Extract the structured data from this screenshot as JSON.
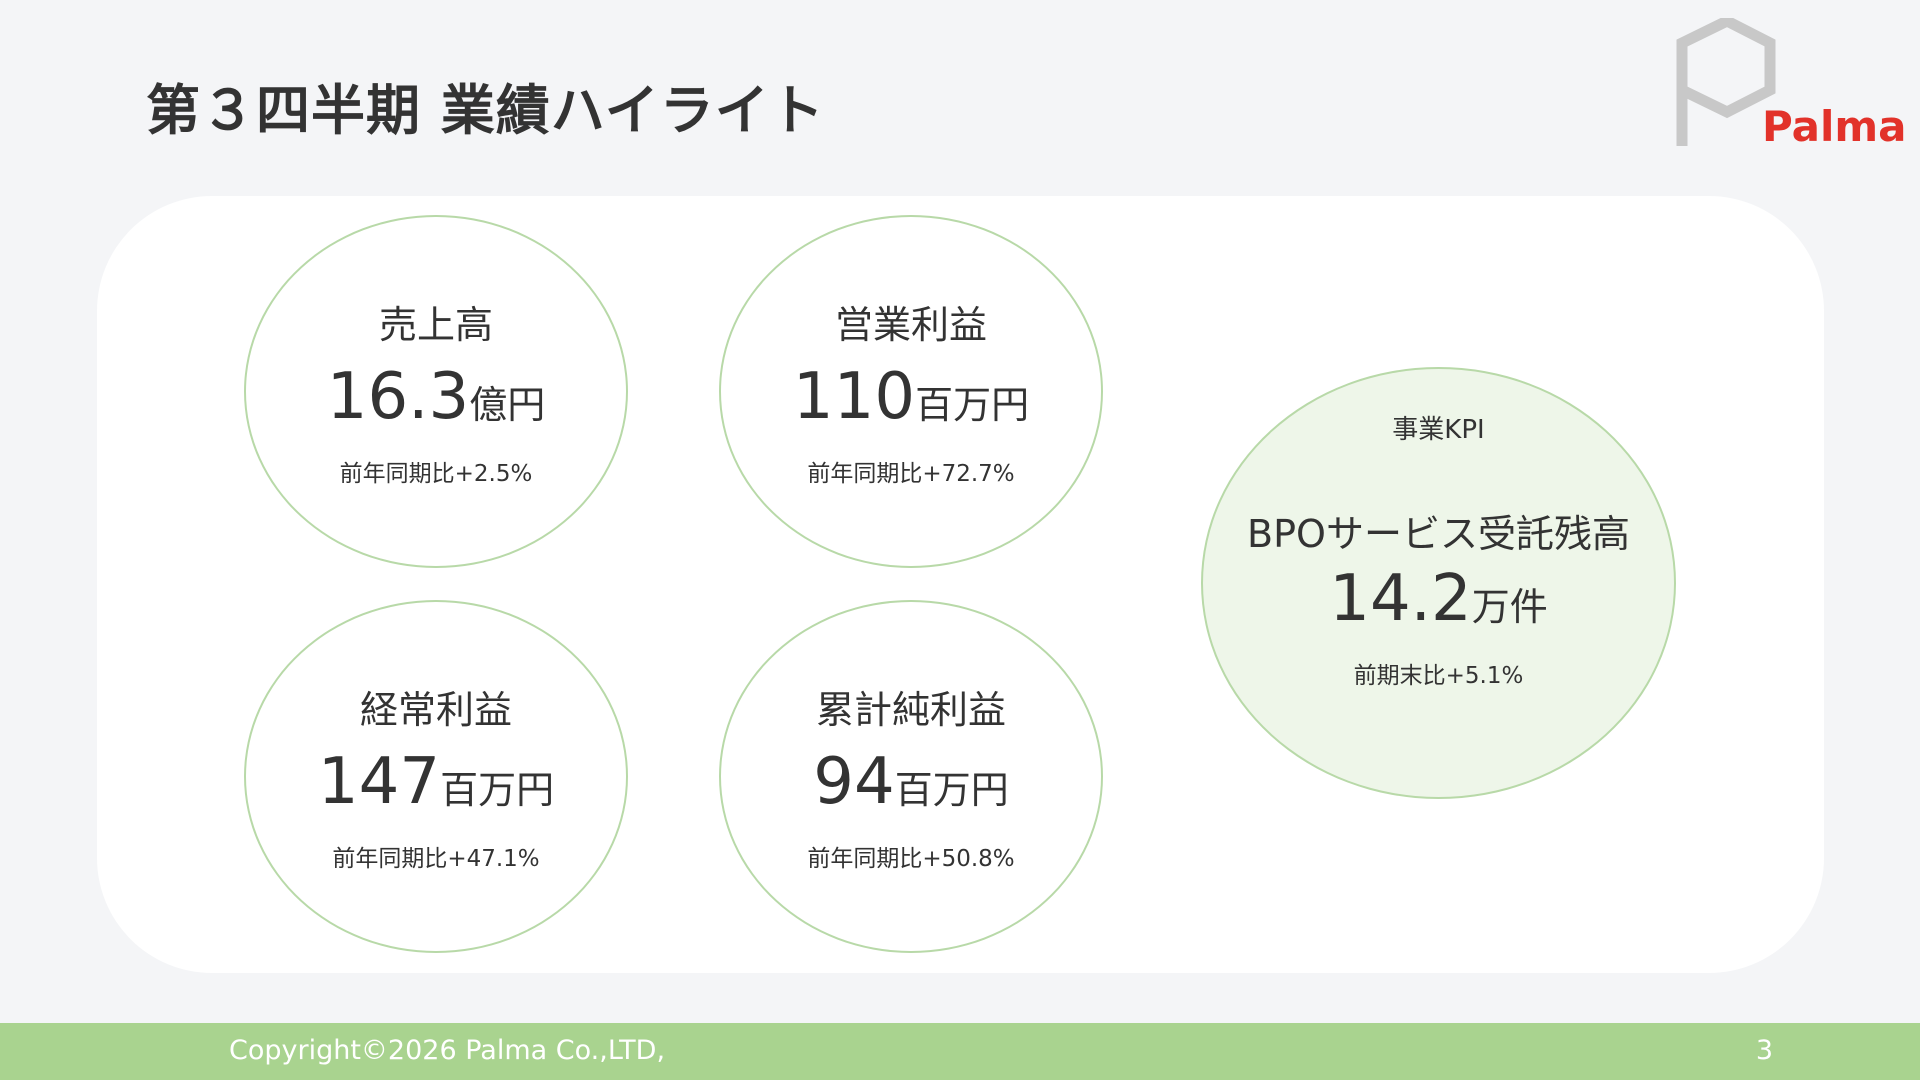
{
  "slide": {
    "title": "第３四半期 業績ハイライト",
    "page_number": "3"
  },
  "logo": {
    "text": "Palma",
    "brand_color": "#e2322a",
    "mark_color": "#c8c8c8"
  },
  "metrics": [
    {
      "label": "売上高",
      "value": "16.3",
      "unit": "億円",
      "note": "前年同期比+2.5%"
    },
    {
      "label": "営業利益",
      "value": "110",
      "unit": "百万円",
      "note": "前年同期比+72.7%"
    },
    {
      "label": "経常利益",
      "value": "147",
      "unit": "百万円",
      "note": "前年同期比+47.1%"
    },
    {
      "label": "累計純利益",
      "value": "94",
      "unit": "百万円",
      "note": "前年同期比+50.8%"
    }
  ],
  "kpi": {
    "header": "事業KPI",
    "label": "BPOサービス受託残高",
    "value": "14.2",
    "unit": "万件",
    "note": "前期末比+5.1%"
  },
  "footer": {
    "copyright": "Copyright©2026 Palma Co.,LTD,",
    "bar_color": "#a9d38f"
  },
  "colors": {
    "circle_border": "#b8d9a8",
    "kpi_fill": "#eef6e9",
    "text": "#333333",
    "background": "#f4f5f7"
  }
}
